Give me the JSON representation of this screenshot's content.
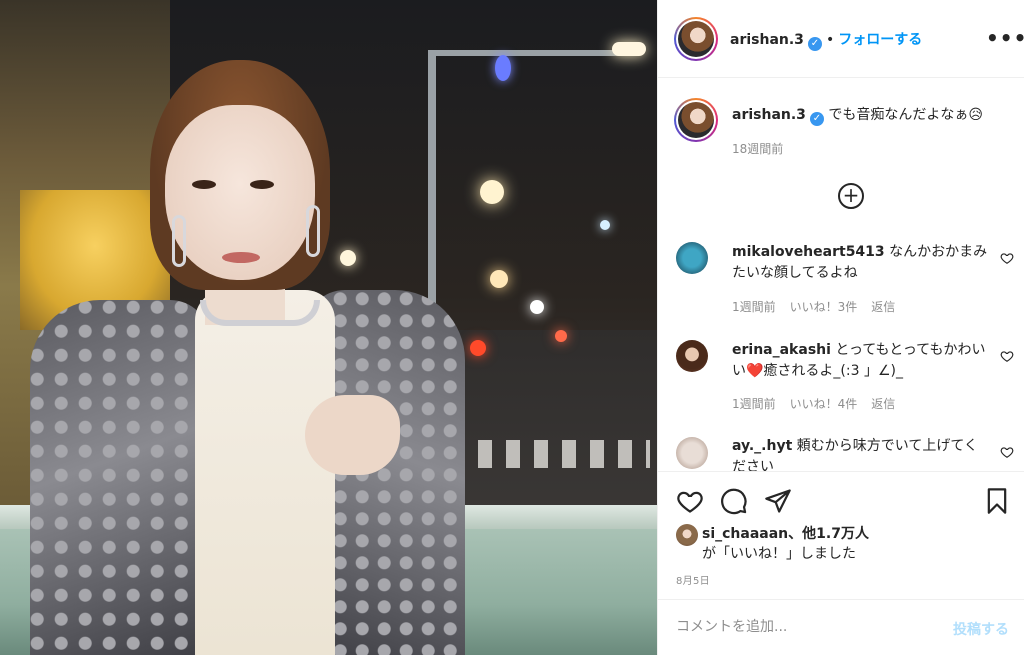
{
  "post": {
    "header": {
      "username": "arishan.3",
      "verified_mark": "✓",
      "separator": "•",
      "follow_label": "フォローする",
      "more_label": "•••"
    },
    "caption": {
      "username": "arishan.3",
      "text": "でも音痴なんだよなぁ😥",
      "time": "18週間前"
    },
    "load_more_label": "+",
    "comments": [
      {
        "username": "mikaloveheart5413",
        "text": "なんかおかまみたいな顔してるよね",
        "time": "1週間前",
        "likes": "いいね！3件",
        "reply": "返信"
      },
      {
        "username": "erina_akashi",
        "text": "とってもとってもかわいい❤️癒されるよ_(:3 」∠)_",
        "time": "1週間前",
        "likes": "いいね！4件",
        "reply": "返信"
      },
      {
        "username": "ay._.hyt",
        "text": "頼むから味方でいて上げてください",
        "time": "",
        "likes": "",
        "reply": ""
      }
    ],
    "liked_by": {
      "username": "si_chaaaan",
      "rest": "、他1.7万人",
      "line2": "が「いいね！」しました"
    },
    "date": "8月5日",
    "add_comment": {
      "placeholder": "コメントを追加...",
      "post_label": "投稿する"
    },
    "colors": {
      "accent": "#0095f6",
      "verified": "#3897f0",
      "muted": "#8e8e8e",
      "post_disabled": "#b2dffc"
    }
  }
}
